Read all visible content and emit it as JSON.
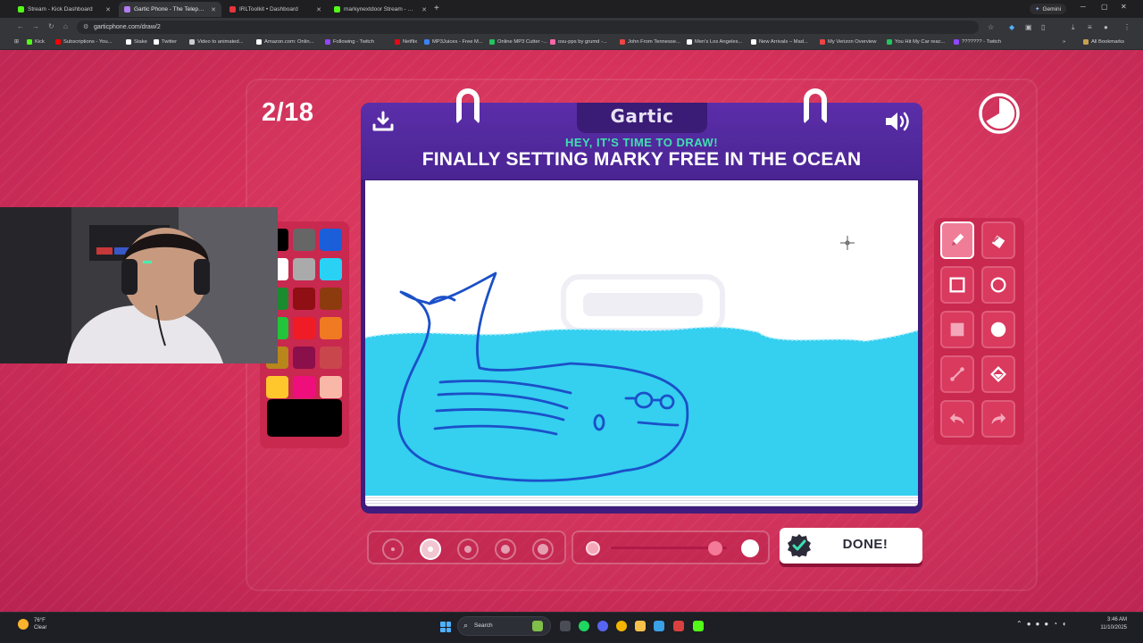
{
  "browser": {
    "tabs": [
      {
        "title": "Stream - Kick Dashboard",
        "favicon_color": "#53fc18",
        "active": false
      },
      {
        "title": "Gartic Phone - The Telephone G",
        "favicon_color": "#b37cf0",
        "active": true
      },
      {
        "title": "IRLToolkit • Dashboard",
        "favicon_color": "#e8343a",
        "active": false
      },
      {
        "title": "markynextdoor Stream - Watch",
        "favicon_color": "#53fc18",
        "active": false
      }
    ],
    "new_tab": "+",
    "gemini_label": "Gemini",
    "url": "garticphone.com/draw/2",
    "bookmarks": [
      {
        "label": "Kick",
        "color": "#53fc18"
      },
      {
        "label": "Subscriptions - You...",
        "color": "#ff0000"
      },
      {
        "label": "Stake",
        "color": "#ffffff"
      },
      {
        "label": "Twitter",
        "color": "#ffffff"
      },
      {
        "label": "Video to animated...",
        "color": "#cccccc"
      },
      {
        "label": "Amazon.com: Onlin...",
        "color": "#ffffff"
      },
      {
        "label": "Following - Twitch",
        "color": "#9146ff"
      },
      {
        "label": "Netflix",
        "color": "#e50914"
      },
      {
        "label": "MP3Juices - Free M...",
        "color": "#3b82f6"
      },
      {
        "label": "Online MP3 Cutter -...",
        "color": "#22c55e"
      },
      {
        "label": "osu-pps by grumd -...",
        "color": "#ff66aa"
      },
      {
        "label": "John From Tennesse...",
        "color": "#ef4444"
      },
      {
        "label": "Men's Los Angeles...",
        "color": "#ffffff"
      },
      {
        "label": "New Arrivals – Mad...",
        "color": "#ffffff"
      },
      {
        "label": "My Verizon Overview",
        "color": "#ef4444"
      },
      {
        "label": "You Hit My Car reac...",
        "color": "#22c55e"
      },
      {
        "label": "??????? - Twitch",
        "color": "#9146ff"
      }
    ],
    "all_bookmarks": "All Bookmarks"
  },
  "game": {
    "round": "2/18",
    "logo": "Gartic",
    "prompt_label": "HEY, IT'S TIME TO DRAW!",
    "prompt": "FINALLY SETTING MARKY FREE IN THE OCEAN",
    "done_label": "DONE!",
    "palette": [
      "#000000",
      "#666666",
      "#1a5fd9",
      "#ffffff",
      "#aaaaaa",
      "#29d2f5",
      "#1c8a2e",
      "#8f0f14",
      "#8c3b0f",
      "#22c43a",
      "#ef1c26",
      "#f07a22",
      "#b8861b",
      "#8a0f4a",
      "#c9464d",
      "#ffc72c",
      "#ee0f7d",
      "#f9b8a7"
    ],
    "current_color": "#000000",
    "brush_sizes": [
      1,
      2,
      3,
      4,
      5
    ],
    "selected_brush_size": 2,
    "opacity": 0.9,
    "tools": [
      {
        "name": "pencil-tool",
        "icon": "pencil-icon",
        "selected": true
      },
      {
        "name": "eraser-tool",
        "icon": "eraser-icon",
        "selected": false
      },
      {
        "name": "rectangle-outline-tool",
        "icon": "square-outline-icon",
        "selected": false
      },
      {
        "name": "ellipse-outline-tool",
        "icon": "circle-outline-icon",
        "selected": false
      },
      {
        "name": "rectangle-fill-tool",
        "icon": "square-filled-icon",
        "selected": false
      },
      {
        "name": "ellipse-fill-tool",
        "icon": "circle-filled-icon",
        "selected": false
      },
      {
        "name": "line-tool",
        "icon": "line-icon",
        "selected": false
      },
      {
        "name": "fill-bucket-tool",
        "icon": "bucket-icon",
        "selected": false
      },
      {
        "name": "undo-tool",
        "icon": "undo-icon",
        "selected": false
      },
      {
        "name": "redo-tool",
        "icon": "redo-icon",
        "selected": false
      }
    ]
  },
  "taskbar": {
    "weather_temp": "76°F",
    "weather_desc": "Clear",
    "search": "Search",
    "time": "3:46 AM",
    "date": "11/10/2025"
  }
}
